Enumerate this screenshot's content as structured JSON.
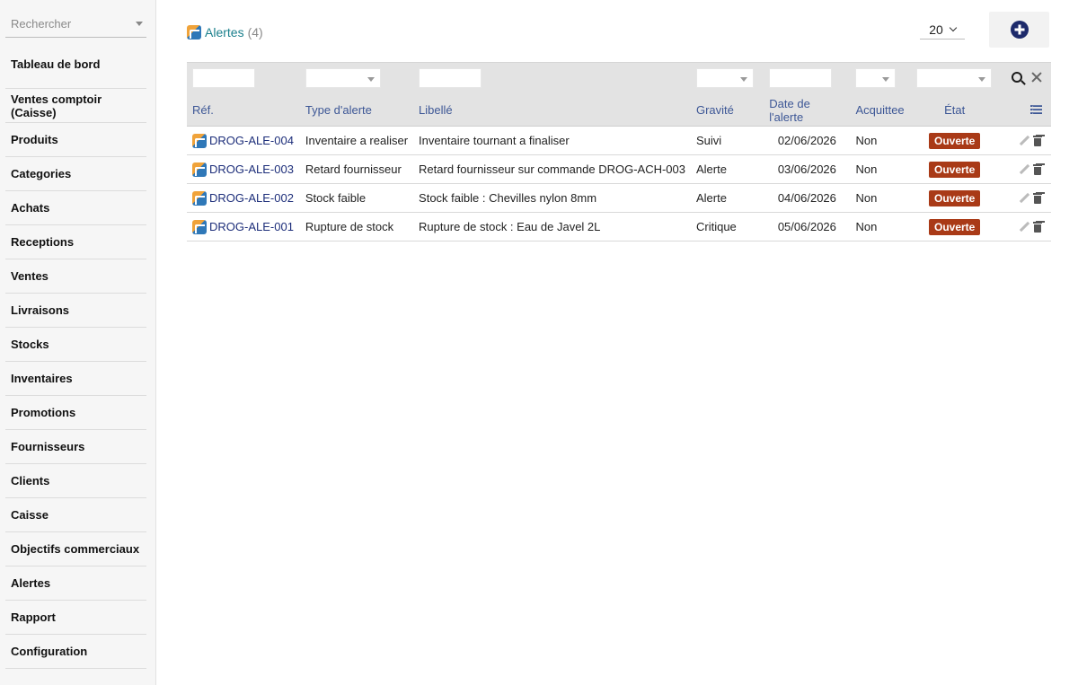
{
  "sidebar": {
    "search_placeholder": "Rechercher",
    "items": [
      {
        "label": "Tableau de bord"
      },
      {
        "label": "Ventes comptoir (Caisse)"
      },
      {
        "label": "Produits"
      },
      {
        "label": "Categories"
      },
      {
        "label": "Achats"
      },
      {
        "label": "Receptions"
      },
      {
        "label": "Ventes"
      },
      {
        "label": "Livraisons"
      },
      {
        "label": "Stocks"
      },
      {
        "label": "Inventaires"
      },
      {
        "label": "Promotions"
      },
      {
        "label": "Fournisseurs"
      },
      {
        "label": "Clients"
      },
      {
        "label": "Caisse"
      },
      {
        "label": "Objectifs commerciaux"
      },
      {
        "label": "Alertes"
      },
      {
        "label": "Rapport"
      },
      {
        "label": "Configuration"
      }
    ]
  },
  "header": {
    "title": "Alertes",
    "count": "(4)",
    "page_size": "20"
  },
  "table": {
    "columns": {
      "ref": "Réf.",
      "type": "Type d'alerte",
      "label": "Libellé",
      "severity": "Gravité",
      "date": "Date de l'alerte",
      "ack": "Acquittee",
      "state": "État"
    },
    "rows": [
      {
        "ref": "DROG-ALE-004",
        "type": "Inventaire a realiser",
        "label": "Inventaire tournant a finaliser",
        "severity": "Suivi",
        "date": "02/06/2026",
        "ack": "Non",
        "state": "Ouverte"
      },
      {
        "ref": "DROG-ALE-003",
        "type": "Retard fournisseur",
        "label": "Retard fournisseur sur commande DROG-ACH-003",
        "severity": "Alerte",
        "date": "03/06/2026",
        "ack": "Non",
        "state": "Ouverte"
      },
      {
        "ref": "DROG-ALE-002",
        "type": "Stock faible",
        "label": "Stock faible : Chevilles nylon 8mm",
        "severity": "Alerte",
        "date": "04/06/2026",
        "ack": "Non",
        "state": "Ouverte"
      },
      {
        "ref": "DROG-ALE-001",
        "type": "Rupture de stock",
        "label": "Rupture de stock : Eau de Javel 2L",
        "severity": "Critique",
        "date": "05/06/2026",
        "ack": "Non",
        "state": "Ouverte"
      }
    ]
  },
  "colors": {
    "accent_title": "#1a7f8c",
    "header_text": "#3d5796",
    "link": "#1d2e7a",
    "badge_open": "#a93a17",
    "add_button": "#1d2a6b"
  }
}
